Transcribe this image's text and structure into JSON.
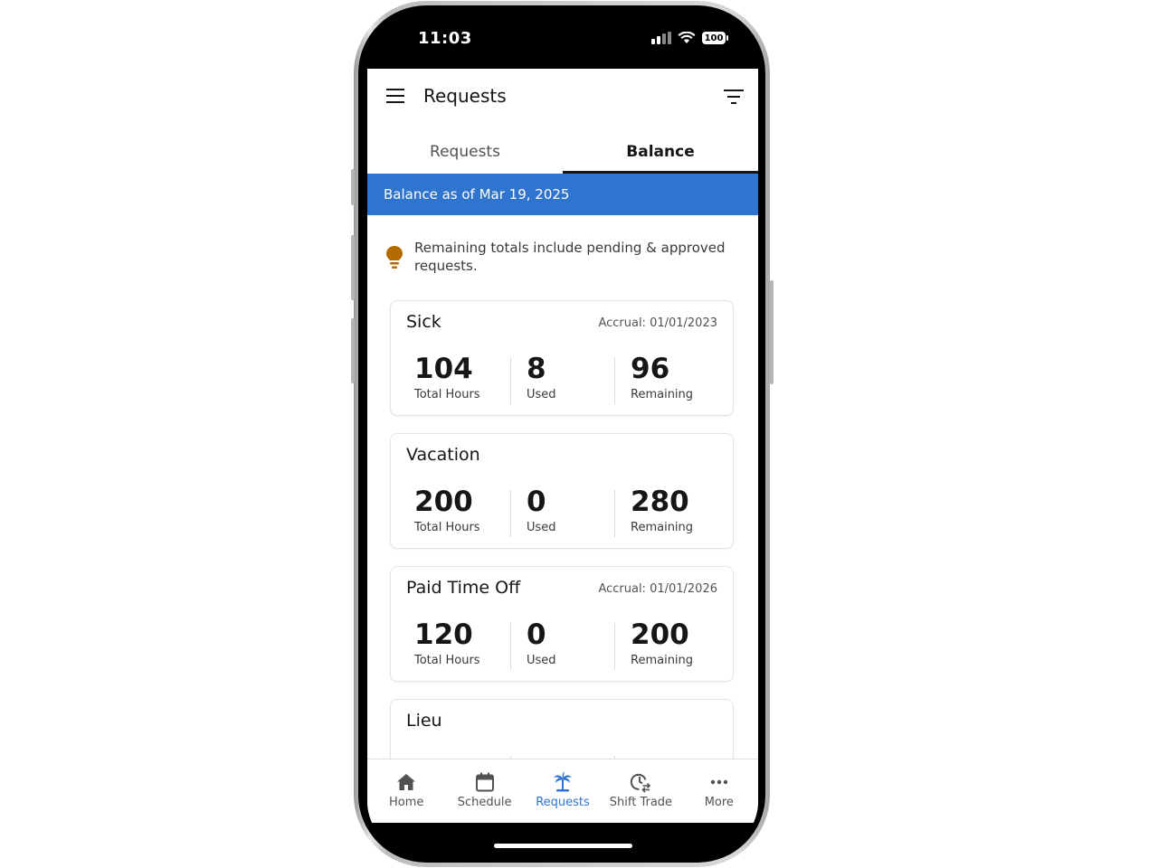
{
  "status_bar": {
    "time": "11:03",
    "battery": "100"
  },
  "header": {
    "title": "Requests"
  },
  "tabs": [
    {
      "label": "Requests",
      "active": false
    },
    {
      "label": "Balance",
      "active": true
    }
  ],
  "balance_banner": "Balance as of Mar 19, 2025",
  "tip": {
    "icon": "lightbulb-icon",
    "text": "Remaining totals include pending & approved requests."
  },
  "cards": [
    {
      "title": "Sick",
      "accrual": "Accrual: 01/01/2023",
      "total": "104",
      "total_label": "Total Hours",
      "used": "8",
      "used_label": "Used",
      "remaining": "96",
      "remaining_label": "Remaining"
    },
    {
      "title": "Vacation",
      "accrual": "",
      "total": "200",
      "total_label": "Total Hours",
      "used": "0",
      "used_label": "Used",
      "remaining": "280",
      "remaining_label": "Remaining"
    },
    {
      "title": "Paid Time Off",
      "accrual": "Accrual: 01/01/2026",
      "total": "120",
      "total_label": "Total Hours",
      "used": "0",
      "used_label": "Used",
      "remaining": "200",
      "remaining_label": "Remaining"
    },
    {
      "title": "Lieu",
      "accrual": "",
      "total": "",
      "total_label": "",
      "used": "",
      "used_label": "",
      "remaining": "",
      "remaining_label": ""
    }
  ],
  "bottom_nav": [
    {
      "label": "Home",
      "icon": "home-icon",
      "active": false
    },
    {
      "label": "Schedule",
      "icon": "calendar-icon",
      "active": false
    },
    {
      "label": "Requests",
      "icon": "palm-tree-icon",
      "active": true
    },
    {
      "label": "Shift Trade",
      "icon": "clock-swap-icon",
      "active": false
    },
    {
      "label": "More",
      "icon": "more-icon",
      "active": false
    }
  ],
  "colors": {
    "accent": "#2f74cf",
    "tip_icon": "#b36b00",
    "text_primary": "#161616"
  }
}
